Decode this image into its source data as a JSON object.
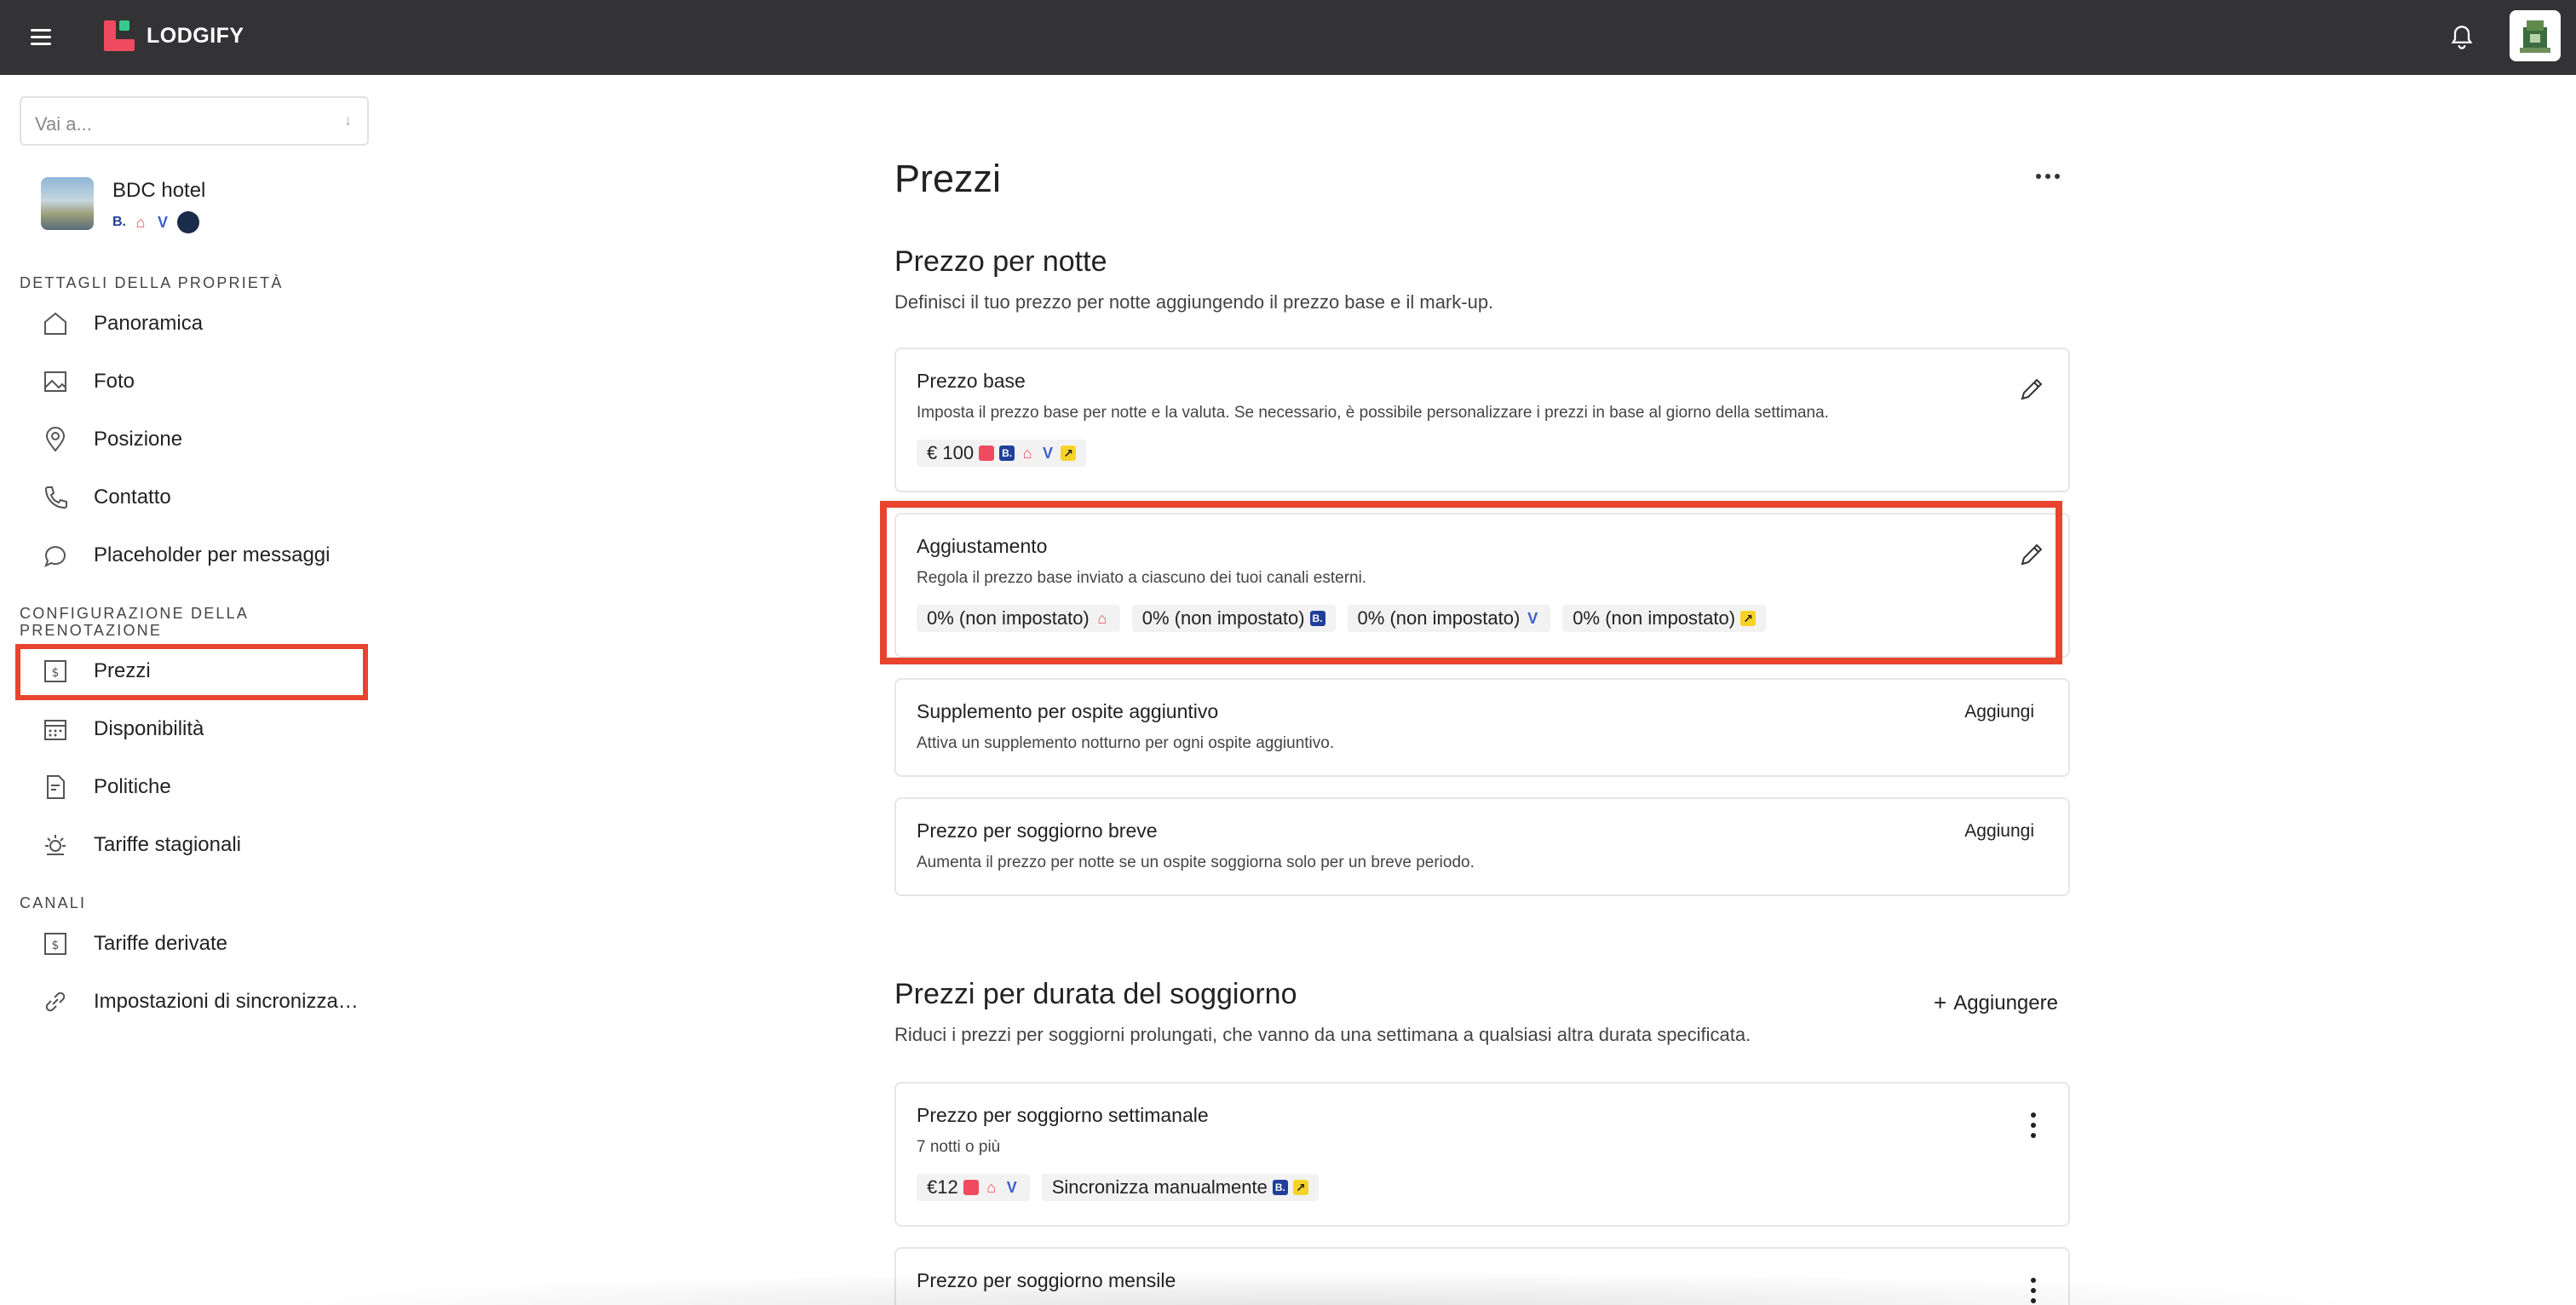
{
  "app": {
    "name": "LODGIFY"
  },
  "sidebar": {
    "goto_placeholder": "Vai a...",
    "property": {
      "name": "BDC hotel",
      "channels": [
        "booking-icon",
        "airbnb-icon",
        "vrbo-icon",
        "expedia-icon"
      ]
    },
    "sections": [
      {
        "title": "DETTAGLI DELLA PROPRIETÀ"
      },
      {
        "title": "CONFIGURAZIONE DELLA PRENOTAZIONE"
      },
      {
        "title": "CANALI"
      }
    ],
    "items": [
      {
        "label": "Panoramica",
        "icon": "home-icon"
      },
      {
        "label": "Foto",
        "icon": "image-icon"
      },
      {
        "label": "Posizione",
        "icon": "location-pin-icon"
      },
      {
        "label": "Contatto",
        "icon": "phone-icon"
      },
      {
        "label": "Placeholder per messaggi",
        "icon": "chat-icon"
      },
      {
        "label": "Prezzi",
        "icon": "price-tag-icon",
        "active": true
      },
      {
        "label": "Disponibilità",
        "icon": "calendar-icon"
      },
      {
        "label": "Politiche",
        "icon": "policy-doc-icon"
      },
      {
        "label": "Tariffe stagionali",
        "icon": "sun-icon"
      },
      {
        "label": "Tariffe derivate",
        "icon": "price-tag-icon"
      },
      {
        "label": "Impostazioni di sincronizza…",
        "icon": "link-icon"
      }
    ]
  },
  "main": {
    "title": "Prezzi",
    "nightly": {
      "heading": "Prezzo per notte",
      "description": "Definisci il tuo prezzo per notte aggiungendo il prezzo base e il mark-up.",
      "base": {
        "title": "Prezzo base",
        "text": "Imposta il prezzo base per notte e la valuta. Se necessario, è possibile personalizzare i prezzi in base al giorno della settimana.",
        "chip": "€ 100"
      },
      "adjustment": {
        "title": "Aggiustamento",
        "text": "Regola il prezzo base inviato a ciascuno dei tuoi canali esterni.",
        "chips": [
          {
            "label": "0% (non impostato)",
            "channel": "airbnb-icon"
          },
          {
            "label": "0% (non impostato)",
            "channel": "booking-icon"
          },
          {
            "label": "0% (non impostato)",
            "channel": "vrbo-icon"
          },
          {
            "label": "0% (non impostato)",
            "channel": "expedia-icon"
          }
        ]
      },
      "extra_guest": {
        "title": "Supplemento per ospite aggiuntivo",
        "text": "Attiva un supplemento notturno per ogni ospite aggiuntivo.",
        "action": "Aggiungi"
      },
      "short_stay": {
        "title": "Prezzo per soggiorno breve",
        "text": "Aumenta il prezzo per notte se un ospite soggiorna solo per un breve periodo.",
        "action": "Aggiungi"
      }
    },
    "duration": {
      "heading": "Prezzi per durata del soggiorno",
      "add_label": "Aggiungere",
      "description": "Riduci i prezzi per soggiorni prolungati, che vanno da una settimana a qualsiasi altra durata specificata.",
      "weekly": {
        "title": "Prezzo per soggiorno settimanale",
        "subtitle": "7 notti o più",
        "chip_price": "€12",
        "chip_manual": "Sincronizza manualmente"
      },
      "monthly": {
        "title": "Prezzo per soggiorno mensile"
      }
    }
  },
  "colors": {
    "topbar": "#333335",
    "brand_red": "#ef4a5f",
    "highlight": "#e8442e"
  }
}
